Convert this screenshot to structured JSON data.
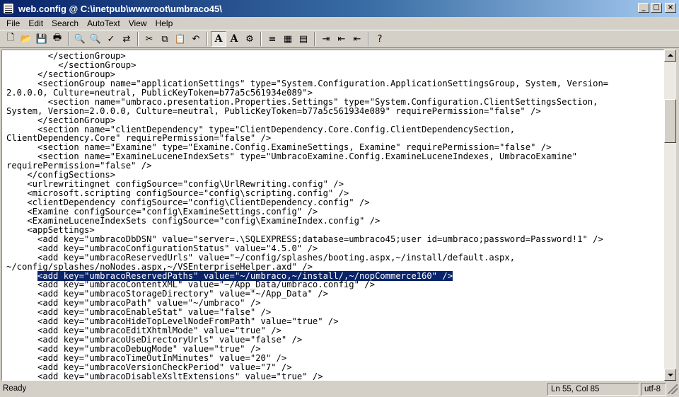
{
  "window": {
    "title": "web.config @ C:\\inetpub\\wwwroot\\umbraco45\\",
    "buttons": {
      "minimize": "_",
      "maximize": "□",
      "close": "×"
    }
  },
  "menu": [
    "File",
    "Edit",
    "Search",
    "AutoText",
    "View",
    "Help"
  ],
  "toolbar": {
    "icons": [
      "new-file-icon",
      "open-folder-icon",
      "save-icon",
      "print-icon",
      "find-icon",
      "find-next-icon",
      "spellcheck-icon",
      "replace-icon",
      "cut-icon",
      "copy-icon",
      "paste-icon",
      "undo-icon",
      "bold-font-icon",
      "font-icon",
      "settings-icon",
      "wrap-icon",
      "hex-icon",
      "page-icon",
      "indent-icon",
      "outdent-icon",
      "unindent-icon",
      "help-icon"
    ],
    "glyphs": [
      "🗋",
      "📂",
      "💾",
      "🖶",
      "🔍",
      "🔍",
      "✓",
      "⇄",
      "✂",
      "⧉",
      "📋",
      "↶",
      "A",
      "A",
      "⚙",
      "≡",
      "▦",
      "▤",
      "⇥",
      "⇤",
      "⇤",
      "?"
    ]
  },
  "editor": {
    "lines": [
      "        </sectionGroup>",
      "          </sectionGroup>",
      "      </sectionGroup>",
      "      <sectionGroup name=\"applicationSettings\" type=\"System.Configuration.ApplicationSettingsGroup, System, Version=",
      "2.0.0.0, Culture=neutral, PublicKeyToken=b77a5c561934e089\">",
      "        <section name=\"umbraco.presentation.Properties.Settings\" type=\"System.Configuration.ClientSettingsSection,",
      "System, Version=2.0.0.0, Culture=neutral, PublicKeyToken=b77a5c561934e089\" requirePermission=\"false\" />",
      "      </sectionGroup>",
      "      <section name=\"clientDependency\" type=\"ClientDependency.Core.Config.ClientDependencySection,",
      "ClientDependency.Core\" requirePermission=\"false\" />",
      "      <section name=\"Examine\" type=\"Examine.Config.ExamineSettings, Examine\" requirePermission=\"false\" />",
      "      <section name=\"ExamineLuceneIndexSets\" type=\"UmbracoExamine.Config.ExamineLuceneIndexes, UmbracoExamine\"",
      "requirePermission=\"false\" />",
      "    </configSections>",
      "    <urlrewritingnet configSource=\"config\\UrlRewriting.config\" />",
      "    <microsoft.scripting configSource=\"config\\scripting.config\" />",
      "    <clientDependency configSource=\"config\\ClientDependency.config\" />",
      "    <Examine configSource=\"config\\ExamineSettings.config\" />",
      "    <ExamineLuceneIndexSets configSource=\"config\\ExamineIndex.config\" />",
      "    <appSettings>",
      "      <add key=\"umbracoDbDSN\" value=\"server=.\\SQLEXPRESS;database=umbraco45;user id=umbraco;password=Password!1\" />",
      "      <add key=\"umbracoConfigurationStatus\" value=\"4.5.0\" />",
      "      <add key=\"umbracoReservedUrls\" value=\"~/config/splashes/booting.aspx,~/install/default.aspx,",
      "~/config/splashes/noNodes.aspx,~/VSEnterpriseHelper.axd\" />",
      "      <add key=\"umbracoReservedPaths\" value=\"~/umbraco,~/install/,~/nopCommerce160\" />",
      "      <add key=\"umbracoContentXML\" value=\"~/App_Data/umbraco.config\" />",
      "      <add key=\"umbracoStorageDirectory\" value=\"~/App_Data\" />",
      "      <add key=\"umbracoPath\" value=\"~/umbraco\" />",
      "      <add key=\"umbracoEnableStat\" value=\"false\" />",
      "      <add key=\"umbracoHideTopLevelNodeFromPath\" value=\"true\" />",
      "      <add key=\"umbracoEditXhtmlMode\" value=\"true\" />",
      "      <add key=\"umbracoUseDirectoryUrls\" value=\"false\" />",
      "      <add key=\"umbracoDebugMode\" value=\"true\" />",
      "      <add key=\"umbracoTimeOutInMinutes\" value=\"20\" />",
      "      <add key=\"umbracoVersionCheckPeriod\" value=\"7\" />",
      "      <add key=\"umbracoDisableXsltExtensions\" value=\"true\" />"
    ],
    "selected_line_index": 24
  },
  "status": {
    "message": "Ready",
    "position": "Ln 55, Col 85",
    "encoding": "utf-8"
  }
}
